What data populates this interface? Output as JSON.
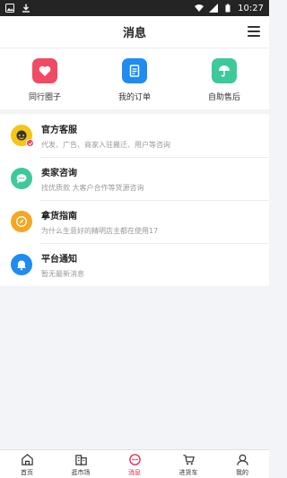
{
  "status_bar": {
    "time": "10:27"
  },
  "header": {
    "title": "消息"
  },
  "quick_actions": [
    {
      "label": "同行圈子",
      "icon": "heart-icon",
      "color": "#f04a64"
    },
    {
      "label": "我的订单",
      "icon": "order-icon",
      "color": "#1e8cf0"
    },
    {
      "label": "自助售后",
      "icon": "umbrella-icon",
      "color": "#3ec99a"
    }
  ],
  "messages": [
    {
      "title": "官方客服",
      "subtitle": "代发、广告、商家入驻搬迁、用户等咨询",
      "icon": "customer-service-icon",
      "color": "#f5c518"
    },
    {
      "title": "卖家咨询",
      "subtitle": "找优质款 大客户合作等货源咨询",
      "icon": "chat-icon",
      "color": "#3ec99a"
    },
    {
      "title": "拿货指南",
      "subtitle": "为什么生意好的精明店主都在使用17",
      "icon": "compass-icon",
      "color": "#f5a623"
    },
    {
      "title": "平台通知",
      "subtitle": "暂无最新消息",
      "icon": "bell-icon",
      "color": "#1e8cf0"
    }
  ],
  "tabs": [
    {
      "label": "首页",
      "icon": "home-icon"
    },
    {
      "label": "逛市场",
      "icon": "market-icon"
    },
    {
      "label": "消息",
      "icon": "message-icon",
      "active": true
    },
    {
      "label": "进货车",
      "icon": "cart-icon"
    },
    {
      "label": "我的",
      "icon": "profile-icon"
    }
  ],
  "colors": {
    "accent": "#e5244b"
  }
}
